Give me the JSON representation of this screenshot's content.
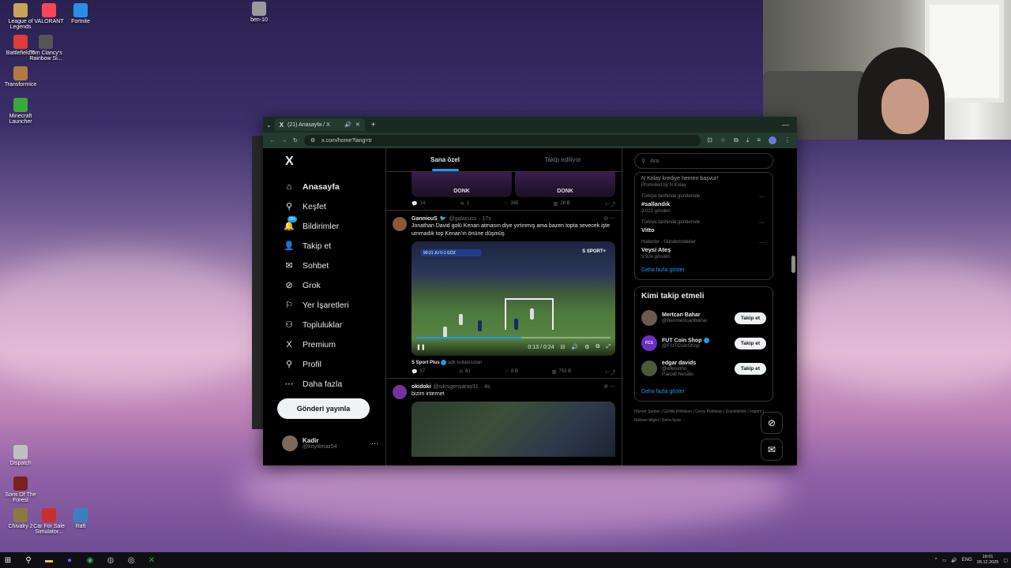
{
  "desktop": {
    "icons": [
      {
        "label": "League of Legends",
        "color": "#c8a45a"
      },
      {
        "label": "VALORANT",
        "color": "#fd4556"
      },
      {
        "label": "Fortnite",
        "color": "#2a8ee8"
      },
      {
        "label": "ben-10",
        "color": "#9a9a9a"
      },
      {
        "label": "Battlefield 6",
        "color": "#e03a3a"
      },
      {
        "label": "Tom Clancy's Rainbow Si...",
        "color": "#555555"
      },
      {
        "label": "Transformice",
        "color": "#b07a42"
      },
      {
        "label": "Minecraft Launcher",
        "color": "#3aa83a"
      },
      {
        "label": "Dispatch",
        "color": "#c0c0c0"
      },
      {
        "label": "Sons Of The Forest",
        "color": "#7a2020"
      },
      {
        "label": "Chivalry 2",
        "color": "#8a7a40"
      },
      {
        "label": "Car For Sale Simulator...",
        "color": "#c83030"
      },
      {
        "label": "Raft",
        "color": "#3a80c0"
      }
    ]
  },
  "browser": {
    "tab_title": "(21) Anasayfa / X",
    "url": "x.com/home?lang=tr"
  },
  "nav": {
    "logo": "X",
    "badge": "20+",
    "items": [
      {
        "label": "Anasayfa",
        "icon": "home-icon",
        "glyph": "⌂"
      },
      {
        "label": "Keşfet",
        "icon": "search-icon",
        "glyph": "⚲"
      },
      {
        "label": "Bildirimler",
        "icon": "bell-icon",
        "glyph": "🔔"
      },
      {
        "label": "Takip et",
        "icon": "add-user-icon",
        "glyph": "👤"
      },
      {
        "label": "Sohbet",
        "icon": "mail-icon",
        "glyph": "✉"
      },
      {
        "label": "Grok",
        "icon": "grok-icon",
        "glyph": "⊘"
      },
      {
        "label": "Yer İşaretleri",
        "icon": "bookmark-icon",
        "glyph": "⚐"
      },
      {
        "label": "Topluluklar",
        "icon": "communities-icon",
        "glyph": "⚇"
      },
      {
        "label": "Premium",
        "icon": "x-premium-icon",
        "glyph": "X"
      },
      {
        "label": "Profil",
        "icon": "profile-icon",
        "glyph": "⚲"
      },
      {
        "label": "Daha fazla",
        "icon": "more-icon",
        "glyph": "⋯"
      }
    ],
    "post_button": "Gönderi yayınla",
    "account": {
      "name": "Kadir",
      "handle": "@knylilmaz54"
    }
  },
  "feed": {
    "tabs": [
      "Sana özel",
      "Takip ediliyor"
    ],
    "donk_label": "DONK",
    "top_actions": {
      "reply": "14",
      "retweet": "1",
      "like": "395",
      "views": "28 B"
    },
    "tweets": [
      {
        "name": "GannicuS",
        "handle": "@galacuss",
        "time": "· 17s",
        "text": "Jonathan David golü Kenan atmasın diye yırtınmış ama bazen topta sevecek işte ummadık top Kenan'ın önüne düşmüş",
        "video": {
          "time": "0:13 / 0:24",
          "progress": 0.54,
          "brand": "S SPORT+",
          "score": "90:21  JU  0-1  GÖZ"
        },
        "source": "S Sport Plus",
        "source_note": "adlı kullanıcıdan",
        "actions": {
          "reply": "57",
          "retweet": "61",
          "like": "8 B",
          "views": "753 B"
        }
      },
      {
        "name": "okidoki",
        "handle": "@sikisgensaray31",
        "time": "· 4s",
        "text": "bizim internet"
      }
    ]
  },
  "sidebar": {
    "search_placeholder": "Ara",
    "promo": {
      "text": "N Kolay krediye hemen başvur!",
      "by": "Promoted by N Kolay"
    },
    "trends": [
      {
        "meta": "Türkiye tarihinde gündemde",
        "name": "#sallandık",
        "count": "3.021 gönderi"
      },
      {
        "meta": "Türkiye tarihinde gündemde",
        "name": "Vitto",
        "count": ""
      },
      {
        "meta": "Haberler · Gündemdekiler",
        "name": "Veysi Ateş",
        "count": "3.924 gönderi"
      }
    ],
    "trends_more": "Daha fazla göster",
    "who_title": "Kimi takip etmeli",
    "who": [
      {
        "name": "Mertcan Bahar",
        "handle": "@benmertcanbahar",
        "note": "",
        "verified": false,
        "avatar_text": "",
        "avatar_color": "#6b5a4e"
      },
      {
        "name": "FUT Coin Shop",
        "handle": "@FUTCoinShop",
        "note": "",
        "verified": true,
        "avatar_text": "FCS",
        "avatar_color": "#6a2fbf"
      },
      {
        "name": "edgar davids",
        "handle": "@efeninho_",
        "note": "Parodi hesabı",
        "verified": false,
        "avatar_text": "",
        "avatar_color": "#4a5a3a"
      }
    ],
    "follow_label": "Takip et",
    "who_more": "Daha fazla göster",
    "footer": "Hizmet Şartları  |  Gizlilik Politikası  |  Çerez Politikası  |  Erişilebilirlik  |  İmprint  |  Reklam bilgisi  |  Daha fazla ···"
  },
  "taskbar": {
    "time": "18:01",
    "date": "28.12.2025"
  }
}
